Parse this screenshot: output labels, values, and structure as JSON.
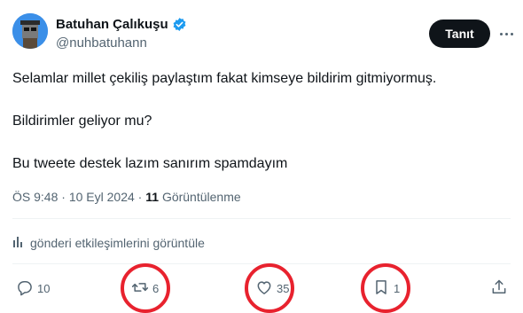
{
  "author": {
    "name": "Batuhan Çalıkuşu",
    "handle": "@nuhbatuhann",
    "verified_icon": "verified-badge-icon",
    "badge_color": "#1d9bf0"
  },
  "header": {
    "follow_label": "Tanıt"
  },
  "tweet": {
    "lines": [
      "Selamlar millet çekiliş paylaştım fakat kimseye bildirim gitmiyormuş.",
      "Bildirimler geliyor mu?",
      "Bu tweete destek lazım sanırım spamdayım"
    ]
  },
  "meta": {
    "time": "ÖS 9:48",
    "date": "10 Eyl 2024",
    "views_count": "11",
    "views_label": "Görüntülenme"
  },
  "engagements_label": "gönderi etkileşimlerini görüntüle",
  "actions": {
    "reply": {
      "icon": "reply-icon",
      "count": "10"
    },
    "retweet": {
      "icon": "retweet-icon",
      "count": "6"
    },
    "like": {
      "icon": "heart-icon",
      "count": "35"
    },
    "bookmark": {
      "icon": "bookmark-icon",
      "count": "1"
    },
    "share": {
      "icon": "share-icon"
    }
  },
  "colors": {
    "text": "#0f1419",
    "secondary": "#536471",
    "highlight_ring": "#e8222e"
  }
}
